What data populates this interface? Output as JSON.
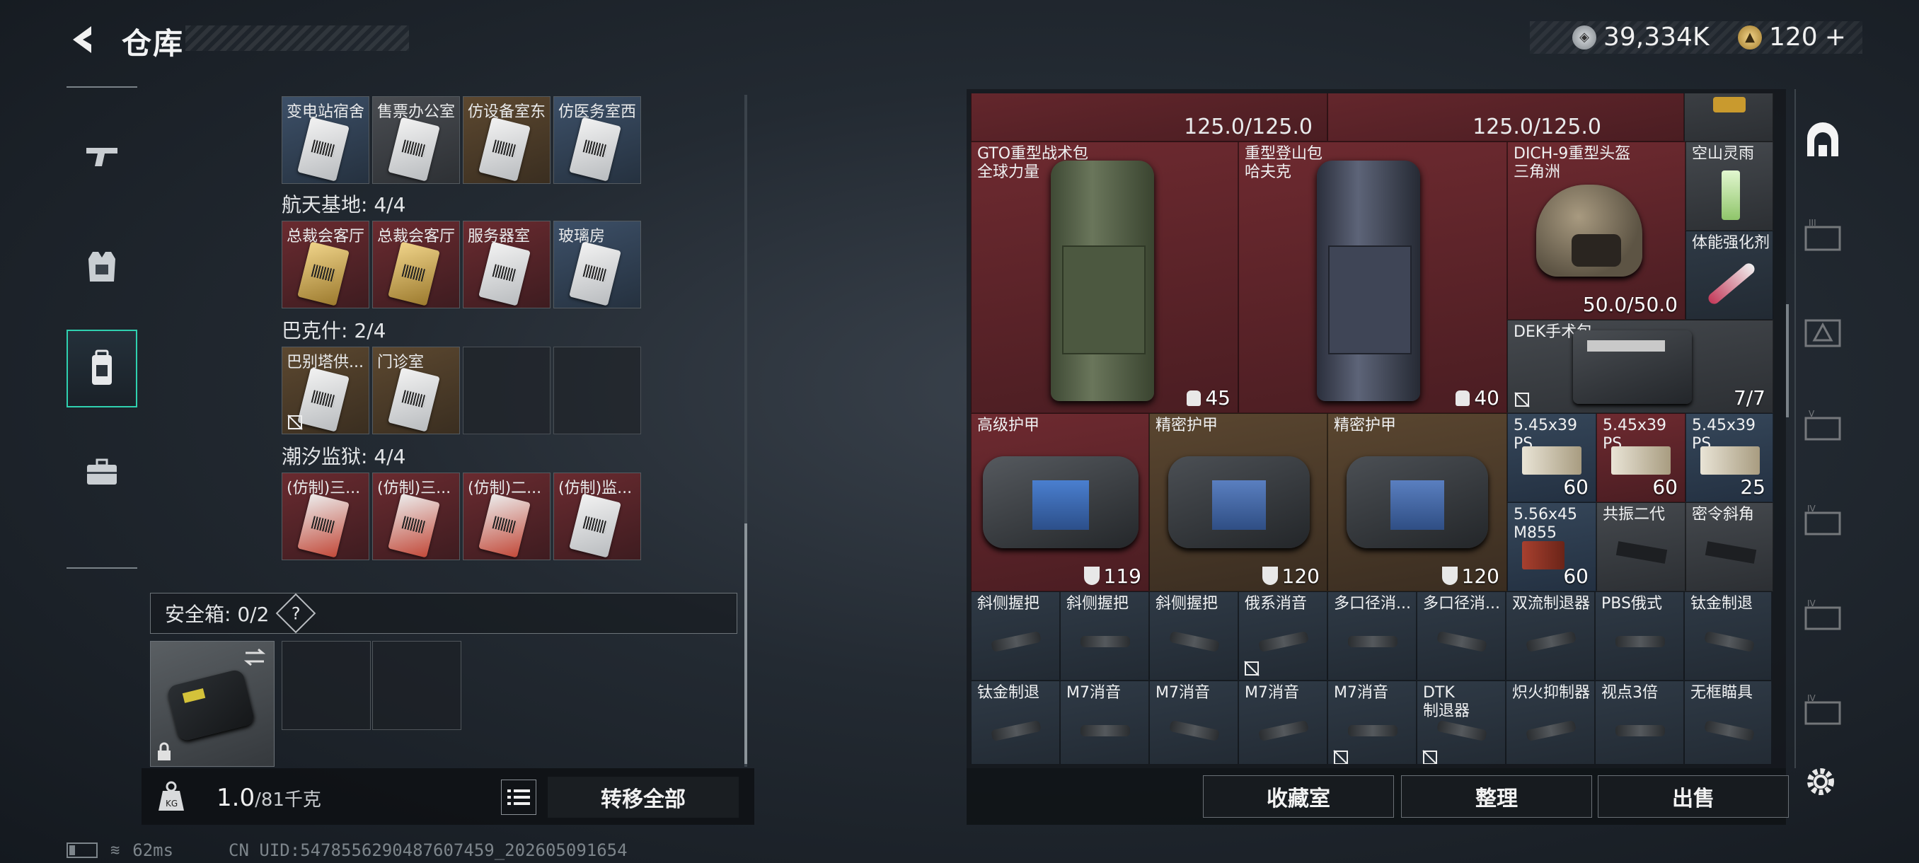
{
  "header": {
    "title": "仓库",
    "currency_main": "39,334K",
    "currency_secondary": "120",
    "currency_add": "+"
  },
  "left_nav": {
    "items": [
      {
        "name": "weapons-tab",
        "icon": "gun-icon"
      },
      {
        "name": "armor-tab",
        "icon": "vest-icon"
      },
      {
        "name": "backpack-tab",
        "icon": "backpack-icon",
        "active": true
      },
      {
        "name": "gear-case-tab",
        "icon": "briefcase-icon"
      }
    ]
  },
  "keys": {
    "row0_labels": [
      "变电站宿舍",
      "售票办公室",
      "仿设备室东",
      "仿医务室西"
    ],
    "sections": [
      {
        "title": "航天基地: 4/4",
        "labels": [
          "总裁会客厅",
          "总裁会客厅",
          "服务器室",
          "玻璃房"
        ]
      },
      {
        "title": "巴克什: 2/4",
        "labels": [
          "巴别塔供...",
          "门诊室",
          "",
          ""
        ]
      },
      {
        "title": "潮汐监狱: 4/4",
        "labels": [
          "(仿制)三...",
          "(仿制)三...",
          "(仿制)二...",
          "(仿制)监..."
        ]
      }
    ]
  },
  "safe_box": {
    "label": "安全箱: 0/2",
    "help": "?"
  },
  "weight": {
    "current": "1.0",
    "max": "/81千克"
  },
  "transfer_all": "转移全部",
  "grid": {
    "top_dur_1": "125.0/125.0",
    "top_dur_2": "125.0/125.0",
    "backpack1": {
      "name": "GTO重型战术包\n全球力量",
      "cap": "45"
    },
    "backpack2": {
      "name": "重型登山包\n哈夫克",
      "cap": "40"
    },
    "helmet": {
      "name": "DICH-9重型头盔\n三角洲",
      "dur": "50.0/50.0"
    },
    "drink": {
      "name": "空山灵雨"
    },
    "injector": {
      "name": "体能强化剂"
    },
    "medkit": {
      "name": "DEK手术包",
      "qty": "7/7"
    },
    "armor1": {
      "name": "高级护甲",
      "val": "119"
    },
    "armor2": {
      "name": "精密护甲",
      "val": "120"
    },
    "armor3": {
      "name": "精密护甲",
      "val": "120"
    },
    "ammo1": {
      "name": "5.45x39\nPS",
      "qty": "60"
    },
    "ammo2": {
      "name": "5.45x39\nPS",
      "qty": "60"
    },
    "ammo3": {
      "name": "5.45x39\nPS",
      "qty": "25"
    },
    "ammo4": {
      "name": "5.56x45\nM855",
      "qty": "60"
    },
    "grip1": {
      "name": "共振二代"
    },
    "grip2": {
      "name": "密令斜角"
    },
    "row5": [
      "斜侧握把",
      "斜侧握把",
      "斜侧握把",
      "俄系消音",
      "多口径消...",
      "多口径消...",
      "双流制退器",
      "PBS俄式",
      "钛金制退"
    ],
    "row6": [
      "钛金制退",
      "M7消音",
      "M7消音",
      "M7消音",
      "M7消音",
      "DTK\n制退器",
      "炽火抑制器",
      "视点3倍",
      "无框瞄具"
    ]
  },
  "right_buttons": {
    "collection": "收藏室",
    "organize": "整理",
    "sell": "出售"
  },
  "right_tabs": [
    "home-tab",
    "tier3-tab",
    "tier3-alt-tab",
    "tier5-tab",
    "tier4-tab",
    "tier4-alt-tab",
    "tier4-third-tab"
  ],
  "status": {
    "ping": "62ms",
    "uid": "CN UID:5478556290487607459_202605091654"
  }
}
